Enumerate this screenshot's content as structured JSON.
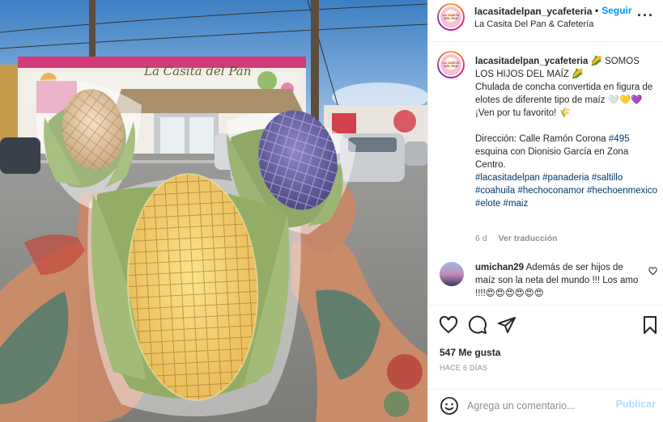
{
  "header": {
    "avatar_label": "LA CASITA DEL PAN",
    "username": "lacasitadelpan_ycafeteria",
    "separator": "•",
    "follow_label": "Seguir",
    "subtitle": "La Casita Del Pan & Cafetería",
    "more_label": "···"
  },
  "photo": {
    "shop_sign": "La Casita del Pan"
  },
  "caption": {
    "username": "lacasitadelpan_ycafeteria",
    "line1": " 🌽 SOMOS LOS HIJOS DEL MAÍZ 🌽",
    "line2": "Chulada de concha convertida en figura de elotes de diferente tipo de maíz 🤍💛💜",
    "line3": "¡Ven por tu favorito! 🌾",
    "address_prefix": "Dirección: Calle Ramón Corona ",
    "address_number": "#495",
    "address_suffix": " esquina con Dionisio García en Zona Centro.",
    "hashtags": [
      "#lacasitadelpan",
      "#panaderia",
      "#saltillo",
      "#coahuila",
      "#hechoconamor",
      "#hechoenmexico",
      "#elote",
      "#maiz"
    ],
    "age": "6 d",
    "translate_label": "Ver traducción"
  },
  "comment": {
    "username": "umichan29",
    "text": " Además de ser hijos de maíz son la neta del mundo !!! Los amo !!!!😍😍😍😍😍😍"
  },
  "actions": {
    "icons": [
      "heart-icon",
      "comment-icon",
      "share-icon",
      "save-icon"
    ],
    "likes": "547 Me gusta",
    "timestamp": "HACE 6 DÍAS"
  },
  "composer": {
    "placeholder": "Agrega un comentario...",
    "publish_label": "Publicar"
  },
  "colors": {
    "link": "#00376b",
    "accent": "#0095f6",
    "publish_disabled": "#b3dbff",
    "muted": "#8e8e8e"
  }
}
